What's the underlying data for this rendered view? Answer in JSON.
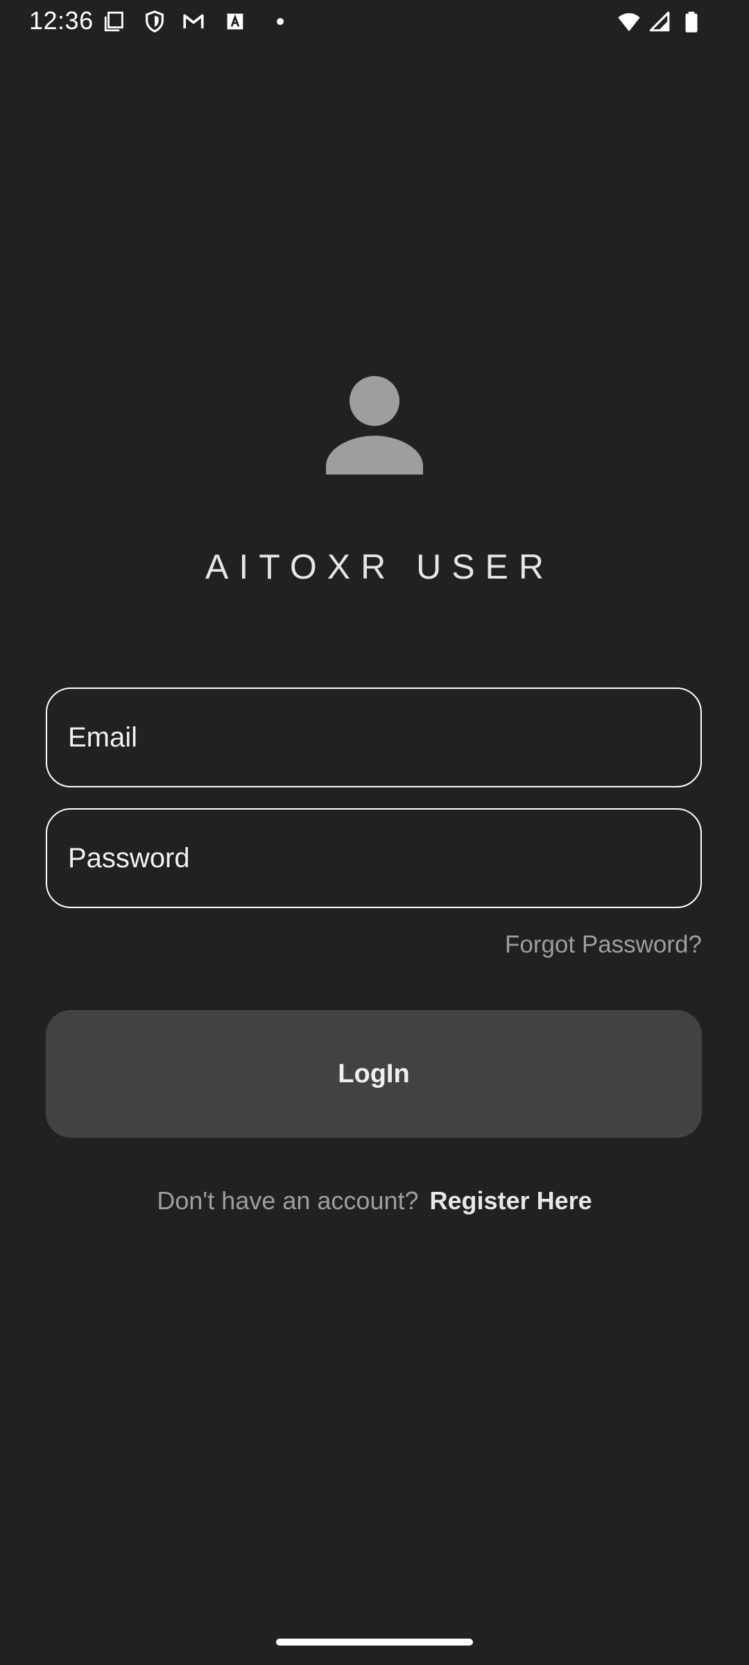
{
  "status_bar": {
    "time": "12:36",
    "left_icons": [
      "screen-icon",
      "shield-icon",
      "gmail-icon",
      "font-icon",
      "dot-icon"
    ],
    "right_icons": [
      "wifi-icon",
      "signal-icon",
      "battery-icon"
    ]
  },
  "header": {
    "avatar_icon": "person-icon",
    "title": "AITOXR USER"
  },
  "form": {
    "email_placeholder": "Email",
    "password_placeholder": "Password",
    "forgot_label": "Forgot Password?",
    "login_label": "LogIn"
  },
  "footer": {
    "register_prompt": "Don't have an account?",
    "register_link": "Register Here"
  },
  "colors": {
    "background": "#212121",
    "button": "#424242",
    "muted_text": "#9e9e9e",
    "avatar": "#9e9e9e"
  }
}
